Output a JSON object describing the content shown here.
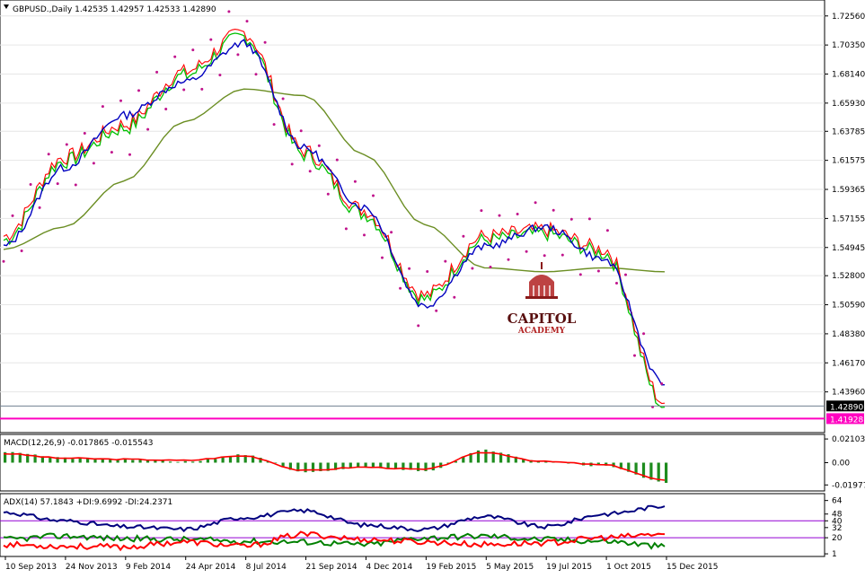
{
  "main": {
    "header": "GBPUSD.,Daily  1.42535 1.42957 1.42533 1.42890",
    "price_ticks": [
      "1.72560",
      "1.70350",
      "1.68140",
      "1.65930",
      "1.63785",
      "1.61575",
      "1.59365",
      "1.57155",
      "1.54945",
      "1.52800",
      "1.50590",
      "1.48380",
      "1.46170",
      "1.43960"
    ],
    "current_price": "1.42890",
    "low_line_price": "1.41928",
    "watermark": {
      "name": "CAPITOL",
      "sub": "ACADEMY"
    }
  },
  "macd": {
    "header": "MACD(12,26,9) -0.017865 -0.015543",
    "ticks": [
      "0.021031",
      "0.00",
      "-0.019773"
    ]
  },
  "adx": {
    "header": "ADX(14) 57.1843 +DI:9.6992 -DI:24.2371",
    "ticks": [
      "64",
      "48",
      "40",
      "32",
      "20",
      "1"
    ]
  },
  "x_ticks": [
    "10 Sep 2013",
    "24 Nov 2013",
    "9 Feb 2014",
    "24 Apr 2014",
    "8 Jul 2014",
    "21 Sep 2014",
    "4 Dec 2014",
    "19 Feb 2015",
    "5 May 2015",
    "19 Jul 2015",
    "1 Oct 2015",
    "15 Dec 2015"
  ],
  "colors": {
    "fast_ma": "#00c000",
    "mid_ma": "#ff0000",
    "slow_ma": "#0000c0",
    "long_ma": "#6b8e23",
    "parabolic_sar": "#c0148c",
    "macd_hist": "#1e8c1e",
    "macd_signal": "#ff0000",
    "adx": "#00007f",
    "plus_di": "#008000",
    "minus_di": "#ff0000",
    "level_line": "#9400d3",
    "low_line": "#ff00c0"
  },
  "chart_data": [
    {
      "type": "line",
      "title": "GBPUSD.,Daily",
      "x": [
        "10 Sep 2013",
        "24 Nov 2013",
        "9 Feb 2014",
        "24 Apr 2014",
        "8 Jul 2014",
        "21 Sep 2014",
        "4 Dec 2014",
        "19 Feb 2015",
        "5 May 2015",
        "19 Jul 2015",
        "1 Oct 2015",
        "15 Dec 2015"
      ],
      "ylim": [
        1.41,
        1.735
      ],
      "series": [
        {
          "values": [
            1.555,
            1.615,
            1.64,
            1.68,
            1.71,
            1.62,
            1.575,
            1.51,
            1.555,
            1.56,
            1.545,
            1.428
          ]
        },
        {
          "values": [
            1.55,
            1.61,
            1.65,
            1.675,
            1.705,
            1.625,
            1.58,
            1.505,
            1.55,
            1.565,
            1.54,
            1.445
          ]
        }
      ]
    },
    {
      "type": "bar",
      "title": "MACD(12,26,9)",
      "x": [
        "10 Sep 2013",
        "24 Nov 2013",
        "9 Feb 2014",
        "24 Apr 2014",
        "8 Jul 2014",
        "21 Sep 2014",
        "4 Dec 2014",
        "19 Feb 2015",
        "5 May 2015",
        "19 Jul 2015",
        "1 Oct 2015",
        "15 Dec 2015"
      ],
      "ylim": [
        -0.0235,
        0.0235
      ],
      "series": [
        {
          "values": [
            0.01,
            0.004,
            0.003,
            0.001,
            0.007,
            -0.009,
            -0.004,
            -0.007,
            0.011,
            0.001,
            -0.003,
            -0.0179
          ]
        },
        {
          "values": [
            0.008,
            0.004,
            0.003,
            0.002,
            0.006,
            -0.007,
            -0.004,
            -0.006,
            0.009,
            0.001,
            -0.002,
            -0.0155
          ]
        }
      ]
    },
    {
      "type": "line",
      "title": "ADX(14)",
      "x": [
        "10 Sep 2013",
        "24 Nov 2013",
        "9 Feb 2014",
        "24 Apr 2014",
        "8 Jul 2014",
        "21 Sep 2014",
        "4 Dec 2014",
        "19 Feb 2015",
        "5 May 2015",
        "19 Jul 2015",
        "1 Oct 2015",
        "15 Dec 2015"
      ],
      "ylim": [
        0,
        70
      ],
      "series": [
        {
          "values": [
            50,
            40,
            33,
            30,
            44,
            52,
            35,
            30,
            45,
            33,
            48,
            57.18
          ]
        },
        {
          "values": [
            18,
            22,
            19,
            18,
            16,
            15,
            12,
            20,
            22,
            18,
            16,
            9.7
          ]
        },
        {
          "values": [
            12,
            10,
            9,
            15,
            10,
            24,
            18,
            15,
            12,
            14,
            20,
            24.24
          ]
        }
      ]
    }
  ]
}
